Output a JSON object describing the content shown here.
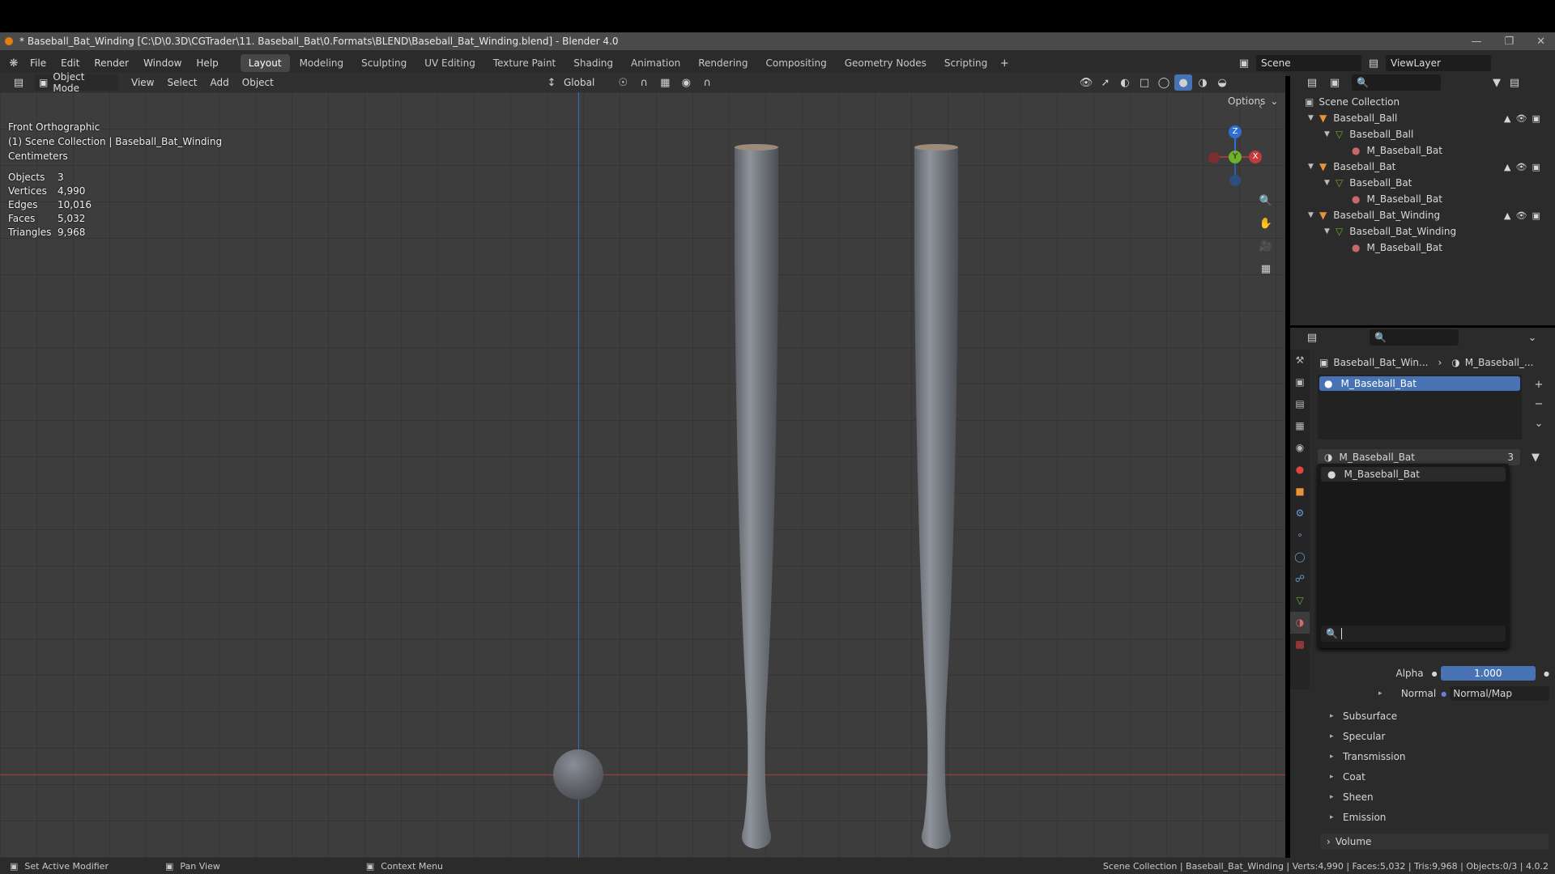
{
  "window": {
    "title": "* Baseball_Bat_Winding [C:\\D\\0.3D\\CGTrader\\11. Baseball_Bat\\0.Formats\\BLEND\\Baseball_Bat_Winding.blend] - Blender 4.0"
  },
  "menu": [
    "File",
    "Edit",
    "Render",
    "Window",
    "Help"
  ],
  "workspaces": [
    "Layout",
    "Modeling",
    "Sculpting",
    "UV Editing",
    "Texture Paint",
    "Shading",
    "Animation",
    "Rendering",
    "Compositing",
    "Geometry Nodes",
    "Scripting"
  ],
  "scene": {
    "name": "Scene",
    "view_layer": "ViewLayer"
  },
  "viewport_header": {
    "mode": "Object Mode",
    "menus": [
      "View",
      "Select",
      "Add",
      "Object"
    ],
    "orientation": "Global",
    "options": "Options"
  },
  "overlay": {
    "view_name": "Front Orthographic",
    "collection": "(1) Scene Collection | Baseball_Bat_Winding",
    "units": "Centimeters",
    "stats": [
      {
        "label": "Objects",
        "value": "3"
      },
      {
        "label": "Vertices",
        "value": "4,990"
      },
      {
        "label": "Edges",
        "value": "10,016"
      },
      {
        "label": "Faces",
        "value": "5,032"
      },
      {
        "label": "Triangles",
        "value": "9,968"
      }
    ]
  },
  "gizmo": {
    "z": "Z",
    "y": "Y",
    "x": "X"
  },
  "outliner": {
    "root": "Scene Collection",
    "items": [
      {
        "label": "Baseball_Ball",
        "level": 0,
        "kind": "object"
      },
      {
        "label": "Baseball_Ball",
        "level": 1,
        "kind": "mesh"
      },
      {
        "label": "M_Baseball_Bat",
        "level": 2,
        "kind": "material"
      },
      {
        "label": "Baseball_Bat",
        "level": 0,
        "kind": "object"
      },
      {
        "label": "Baseball_Bat",
        "level": 1,
        "kind": "mesh"
      },
      {
        "label": "M_Baseball_Bat",
        "level": 2,
        "kind": "material"
      },
      {
        "label": "Baseball_Bat_Winding",
        "level": 0,
        "kind": "object"
      },
      {
        "label": "Baseball_Bat_Winding",
        "level": 1,
        "kind": "mesh"
      },
      {
        "label": "M_Baseball_Bat",
        "level": 2,
        "kind": "material"
      }
    ]
  },
  "properties": {
    "breadcrumb_object": "Baseball_Bat_Win...",
    "breadcrumb_material": "M_Baseball_...",
    "slot": "M_Baseball_Bat",
    "material_field": "M_Baseball_Bat",
    "material_users": "3",
    "dropdown_item": "M_Baseball_Bat",
    "alpha_label": "Alpha",
    "alpha_value": "1.000",
    "normal_label": "Normal",
    "normal_value": "Normal/Map",
    "sections": [
      "Subsurface",
      "Specular",
      "Transmission",
      "Coat",
      "Sheen",
      "Emission"
    ],
    "volume": "Volume"
  },
  "statusbar": {
    "left1": "Set Active Modifier",
    "left2": "Pan View",
    "left3": "Context Menu",
    "right": "Scene Collection | Baseball_Bat_Winding | Verts:4,990 | Faces:5,032 | Tris:9,968 | Objects:0/3 | 4.0.2"
  },
  "colors": {
    "accent": "#4772b3",
    "x_axis": "#c23b3b",
    "y_axis": "#6fb12b",
    "z_axis": "#2e6fd1",
    "object_orange": "#e8923a"
  }
}
